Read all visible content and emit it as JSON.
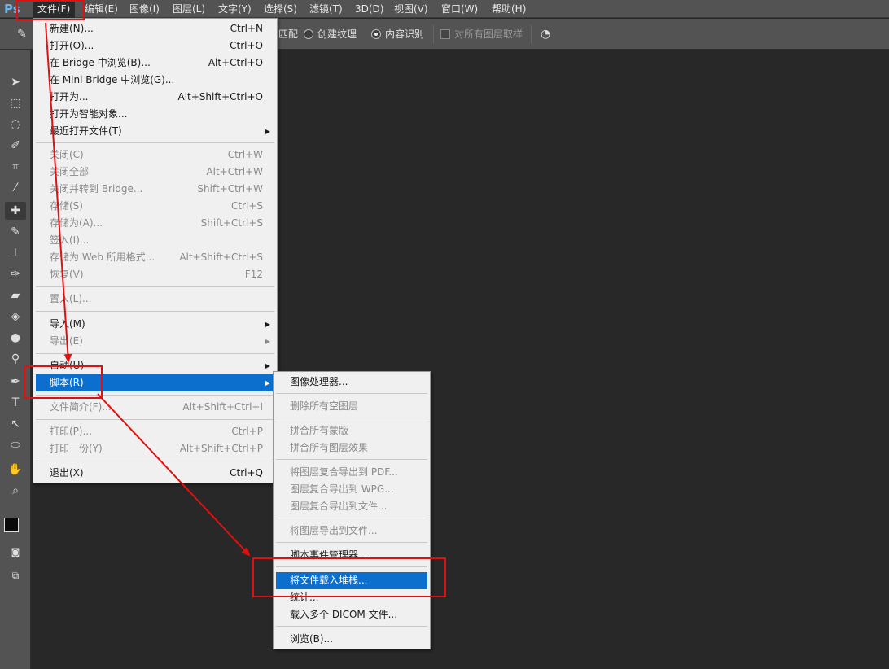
{
  "menubar": {
    "logo": "Ps",
    "items": [
      "文件(F)",
      "编辑(E)",
      "图像(I)",
      "图层(L)",
      "文字(Y)",
      "选择(S)",
      "滤镜(T)",
      "3D(D)",
      "视图(V)",
      "窗口(W)",
      "帮助(H)"
    ]
  },
  "options": {
    "match_label": "匹配",
    "texture_label": "创建纹理",
    "content_aware_label": "内容识别",
    "sample_all_label": "对所有图层取样"
  },
  "file_menu": {
    "new": {
      "label": "新建(N)...",
      "shortcut": "Ctrl+N"
    },
    "open": {
      "label": "打开(O)...",
      "shortcut": "Ctrl+O"
    },
    "browse_bridge": {
      "label": "在 Bridge 中浏览(B)...",
      "shortcut": "Alt+Ctrl+O"
    },
    "browse_mini_bridge": {
      "label": "在 Mini Bridge 中浏览(G)..."
    },
    "open_as": {
      "label": "打开为...",
      "shortcut": "Alt+Shift+Ctrl+O"
    },
    "open_smart": {
      "label": "打开为智能对象..."
    },
    "recent": {
      "label": "最近打开文件(T)"
    },
    "close": {
      "label": "关闭(C)",
      "shortcut": "Ctrl+W"
    },
    "close_all": {
      "label": "关闭全部",
      "shortcut": "Alt+Ctrl+W"
    },
    "close_go_bridge": {
      "label": "关闭并转到 Bridge...",
      "shortcut": "Shift+Ctrl+W"
    },
    "save": {
      "label": "存储(S)",
      "shortcut": "Ctrl+S"
    },
    "save_as": {
      "label": "存储为(A)...",
      "shortcut": "Shift+Ctrl+S"
    },
    "check_in": {
      "label": "签入(I)..."
    },
    "save_web": {
      "label": "存储为 Web 所用格式...",
      "shortcut": "Alt+Shift+Ctrl+S"
    },
    "revert": {
      "label": "恢复(V)",
      "shortcut": "F12"
    },
    "place": {
      "label": "置入(L)..."
    },
    "import": {
      "label": "导入(M)"
    },
    "export": {
      "label": "导出(E)"
    },
    "automate": {
      "label": "自动(U)"
    },
    "scripts": {
      "label": "脚本(R)"
    },
    "file_info": {
      "label": "文件简介(F)...",
      "shortcut": "Alt+Shift+Ctrl+I"
    },
    "print": {
      "label": "打印(P)...",
      "shortcut": "Ctrl+P"
    },
    "print_one": {
      "label": "打印一份(Y)",
      "shortcut": "Alt+Shift+Ctrl+P"
    },
    "exit": {
      "label": "退出(X)",
      "shortcut": "Ctrl+Q"
    }
  },
  "scripts_menu": {
    "image_processor": "图像处理器...",
    "delete_empty_layers": "删除所有空图层",
    "flatten_masks": "拼合所有蒙版",
    "flatten_effects": "拼合所有图层效果",
    "comps_to_pdf": "将图层复合导出到 PDF...",
    "comps_to_wpg": "图层复合导出到 WPG...",
    "comps_to_files": "图层复合导出到文件...",
    "layers_to_files": "将图层导出到文件...",
    "event_manager": "脚本事件管理器...",
    "load_into_stack": "将文件载入堆栈...",
    "statistics": "统计...",
    "load_dicom": "载入多个 DICOM 文件...",
    "browse": "浏览(B)..."
  },
  "colors": {
    "highlight": "#0c6fcd",
    "annotation_red": "#e01010",
    "canvas_bg": "#282828",
    "chrome_bg": "#535353"
  }
}
